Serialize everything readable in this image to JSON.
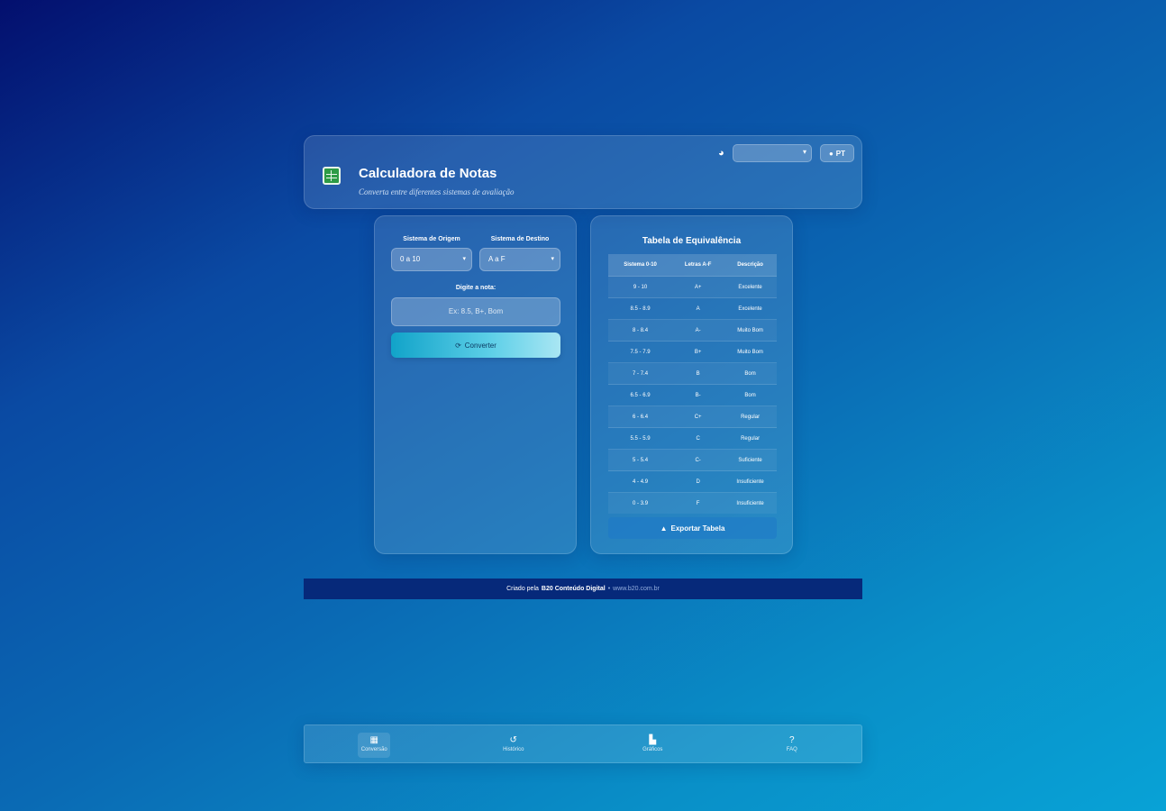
{
  "header": {
    "title": "Calculadora de Notas",
    "subtitle": "Converta entre diferentes sistemas de avaliação",
    "theme_icon": "palette-icon",
    "theme_select_value": "",
    "lang_icon": "globe-icon",
    "lang_label": "PT"
  },
  "converter": {
    "source_label": "Sistema de Origem",
    "source_value": "0 a 10",
    "target_label": "Sistema de Destino",
    "target_value": "A a F",
    "input_label": "Digite a nota:",
    "input_placeholder": "Ex: 8.5, B+, Bom",
    "convert_icon": "refresh-icon",
    "convert_label": "Converter"
  },
  "equivalence": {
    "title": "Tabela de Equivalência",
    "columns": [
      "Sistema 0-10",
      "Letras A-F",
      "Descrição"
    ],
    "rows": [
      [
        "9 - 10",
        "A+",
        "Excelente"
      ],
      [
        "8.5 - 8.9",
        "A",
        "Excelente"
      ],
      [
        "8 - 8.4",
        "A-",
        "Muito Bom"
      ],
      [
        "7.5 - 7.9",
        "B+",
        "Muito Bom"
      ],
      [
        "7 - 7.4",
        "B",
        "Bom"
      ],
      [
        "6.5 - 6.9",
        "B-",
        "Bom"
      ],
      [
        "6 - 6.4",
        "C+",
        "Regular"
      ],
      [
        "5.5 - 5.9",
        "C",
        "Regular"
      ],
      [
        "5 - 5.4",
        "C-",
        "Suficiente"
      ],
      [
        "4 - 4.9",
        "D",
        "Insuficiente"
      ],
      [
        "0 - 3.9",
        "F",
        "Insuficiente"
      ]
    ],
    "export_icon": "warning-icon",
    "export_label": "Exportar Tabela"
  },
  "footer": {
    "prefix": "Criado pela",
    "brand": "B20 Conteúdo Digital",
    "separator": "•",
    "link": "www.b20.com.br"
  },
  "nav": {
    "items": [
      {
        "label": "Conversão",
        "icon": "calculator-icon",
        "glyph": "▦"
      },
      {
        "label": "Histórico",
        "icon": "history-icon",
        "glyph": "↺"
      },
      {
        "label": "Gráficos",
        "icon": "chart-icon",
        "glyph": "▙"
      },
      {
        "label": "FAQ",
        "icon": "help-icon",
        "glyph": "?"
      }
    ]
  }
}
